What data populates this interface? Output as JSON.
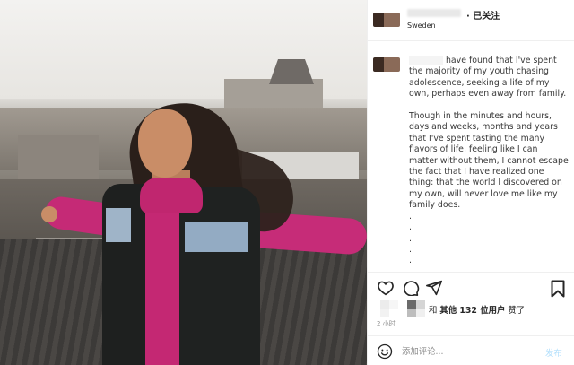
{
  "header": {
    "follow_label": "· 已关注",
    "location": "Sweden"
  },
  "caption": {
    "lead": "have found that I've spent the majority of my youth chasing adolescence, seeking a life of my own, perhaps even away from family.",
    "paragraph2": "Though in the minutes and hours, days and weeks, months and years that I've spent tasting the many flavors of life, feeling like I can matter without them, I cannot escape the fact that I have realized one thing: that the world I discovered on my own, will never love me like my family does.",
    "dots": ".\n.\n.\n.\n.\n.\n."
  },
  "likes": {
    "prefix": "和",
    "bold": "其他 132 位用户",
    "suffix": " 赞了"
  },
  "time": "2 小时",
  "comment": {
    "placeholder": "添加评论...",
    "post_label": "发布"
  },
  "icons": {
    "heart": "heart-icon",
    "comment": "comment-icon",
    "share": "share-icon",
    "save": "bookmark-icon",
    "emoji": "emoji-icon"
  }
}
